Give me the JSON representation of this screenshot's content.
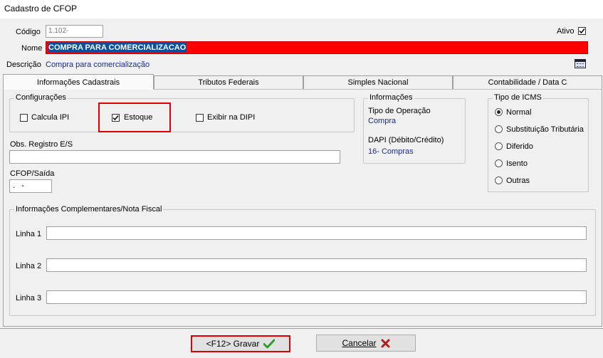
{
  "window": {
    "title": "Cadastro de CFOP"
  },
  "header": {
    "codigo_label": "Código",
    "codigo_value": "1.102-",
    "ativo_label": "Ativo",
    "nome_label": "Nome",
    "nome_value": "COMPRA PARA COMERCIALIZACAO",
    "descricao_label": "Descrição",
    "descricao_value": "Compra para comercialização"
  },
  "tabs": [
    {
      "label": "Informações Cadastrais"
    },
    {
      "label": "Tributos Federais"
    },
    {
      "label": "Simples Nacional"
    },
    {
      "label": "Contabilidade / Data C"
    }
  ],
  "configuracoes": {
    "title": "Configurações",
    "calcula_ipi": "Calcula IPI",
    "estoque": "Estoque",
    "exibir_dipi": "Exibir na DIPI"
  },
  "informacoes": {
    "title": "Informações",
    "tipo_operacao_label": "Tipo de Operação",
    "tipo_operacao_value": "Compra",
    "dapi_label": "DAPI (Débito/Crédito)",
    "dapi_value": "16- Compras"
  },
  "tipo_icms": {
    "title": "Tipo de ICMS",
    "options": [
      "Normal",
      "Substituição Tributária",
      "Diferido",
      "Isento",
      "Outras"
    ],
    "selected": "Normal"
  },
  "obs": {
    "label": "Obs. Registro E/S"
  },
  "cfop_saida": {
    "label": "CFOP/Saída",
    "value": ".   -"
  },
  "complementares": {
    "title": "Informações Complementares/Nota Fiscal",
    "linha1": "Linha 1",
    "linha2": "Linha 2",
    "linha3": "Linha 3"
  },
  "footer": {
    "gravar": "<F12> Gravar",
    "cancelar": "Cancelar"
  },
  "colors": {
    "nome_bg": "#ff0000",
    "highlight": "#e00000",
    "check_green": "#2e9e2e",
    "cancel_red": "#b01c1c"
  }
}
